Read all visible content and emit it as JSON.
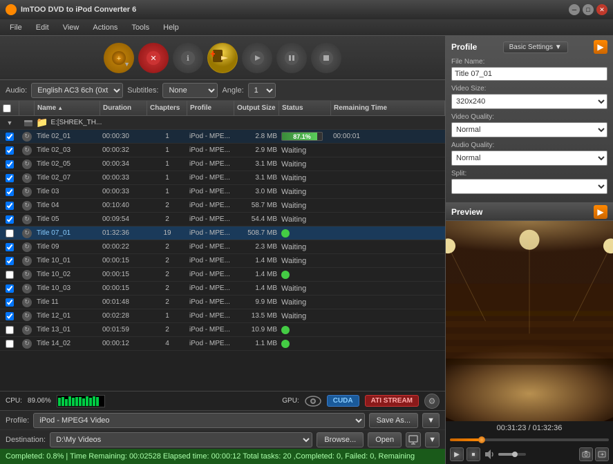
{
  "app": {
    "title": "ImTOO DVD to iPod Converter 6",
    "icon": "dvd-icon"
  },
  "menu": {
    "items": [
      "File",
      "Edit",
      "View",
      "Actions",
      "Tools",
      "Help"
    ]
  },
  "toolbar": {
    "buttons": [
      {
        "id": "add",
        "label": "+",
        "tooltip": "Add"
      },
      {
        "id": "remove",
        "label": "✕",
        "tooltip": "Remove"
      },
      {
        "id": "info",
        "label": "ℹ",
        "tooltip": "Info"
      },
      {
        "id": "convert",
        "label": "▶▶",
        "tooltip": "Convert"
      },
      {
        "id": "play",
        "label": "▶",
        "tooltip": "Play"
      },
      {
        "id": "pause",
        "label": "⏸",
        "tooltip": "Pause"
      },
      {
        "id": "stop",
        "label": "⏹",
        "tooltip": "Stop"
      }
    ]
  },
  "controls": {
    "audio_label": "Audio:",
    "audio_value": "English AC3 6ch (0xt",
    "subtitles_label": "Subtitles:",
    "subtitles_value": "None",
    "angle_label": "Angle:",
    "angle_value": "1"
  },
  "file_list": {
    "columns": [
      "",
      "",
      "Name",
      "Duration",
      "Chapters",
      "Profile",
      "Output Size",
      "Status",
      "Remaining Time"
    ],
    "folder": "E:[SHREK_TH...",
    "files": [
      {
        "name": "Title 02_01",
        "duration": "00:00:30",
        "chapters": "1",
        "profile": "iPod - MPE...",
        "output": "2.8 MB",
        "status": "progress",
        "progress": 87.1,
        "remaining": "00:00:01",
        "checked": true
      },
      {
        "name": "Title 02_03",
        "duration": "00:00:32",
        "chapters": "1",
        "profile": "iPod - MPE...",
        "output": "2.9 MB",
        "status": "Waiting",
        "remaining": "",
        "checked": true
      },
      {
        "name": "Title 02_05",
        "duration": "00:00:34",
        "chapters": "1",
        "profile": "iPod - MPE...",
        "output": "3.1 MB",
        "status": "Waiting",
        "remaining": "",
        "checked": true
      },
      {
        "name": "Title 02_07",
        "duration": "00:00:33",
        "chapters": "1",
        "profile": "iPod - MPE...",
        "output": "3.1 MB",
        "status": "Waiting",
        "remaining": "",
        "checked": true
      },
      {
        "name": "Title 03",
        "duration": "00:00:33",
        "chapters": "1",
        "profile": "iPod - MPE...",
        "output": "3.0 MB",
        "status": "Waiting",
        "remaining": "",
        "checked": true
      },
      {
        "name": "Title 04",
        "duration": "00:10:40",
        "chapters": "2",
        "profile": "iPod - MPE...",
        "output": "58.7 MB",
        "status": "Waiting",
        "remaining": "",
        "checked": true
      },
      {
        "name": "Title 05",
        "duration": "00:09:54",
        "chapters": "2",
        "profile": "iPod - MPE...",
        "output": "54.4 MB",
        "status": "Waiting",
        "remaining": "",
        "checked": true
      },
      {
        "name": "Title 07_01",
        "duration": "01:32:36",
        "chapters": "19",
        "profile": "iPod - MPE...",
        "output": "508.7 MB",
        "status": "green",
        "remaining": "",
        "checked": false,
        "selected": true
      },
      {
        "name": "Title 09",
        "duration": "00:00:22",
        "chapters": "2",
        "profile": "iPod - MPE...",
        "output": "2.3 MB",
        "status": "Waiting",
        "remaining": "",
        "checked": true
      },
      {
        "name": "Title 10_01",
        "duration": "00:00:15",
        "chapters": "2",
        "profile": "iPod - MPE...",
        "output": "1.4 MB",
        "status": "Waiting",
        "remaining": "",
        "checked": true
      },
      {
        "name": "Title 10_02",
        "duration": "00:00:15",
        "chapters": "2",
        "profile": "iPod - MPE...",
        "output": "1.4 MB",
        "status": "green",
        "remaining": "",
        "checked": false
      },
      {
        "name": "Title 10_03",
        "duration": "00:00:15",
        "chapters": "2",
        "profile": "iPod - MPE...",
        "output": "1.4 MB",
        "status": "Waiting",
        "remaining": "",
        "checked": true
      },
      {
        "name": "Title 11",
        "duration": "00:01:48",
        "chapters": "2",
        "profile": "iPod - MPE...",
        "output": "9.9 MB",
        "status": "Waiting",
        "remaining": "",
        "checked": true
      },
      {
        "name": "Title 12_01",
        "duration": "00:02:28",
        "chapters": "1",
        "profile": "iPod - MPE...",
        "output": "13.5 MB",
        "status": "Waiting",
        "remaining": "",
        "checked": true
      },
      {
        "name": "Title 13_01",
        "duration": "00:01:59",
        "chapters": "2",
        "profile": "iPod - MPE...",
        "output": "10.9 MB",
        "status": "green",
        "remaining": "",
        "checked": false
      },
      {
        "name": "Title 14_02",
        "duration": "00:00:12",
        "chapters": "4",
        "profile": "iPod - MPE...",
        "output": "1.1 MB",
        "status": "green",
        "remaining": "",
        "checked": false
      }
    ]
  },
  "cpu_status": {
    "label": "CPU:",
    "value": "89.06%",
    "gpu_label": "GPU:",
    "cuda_label": "CUDA",
    "ati_label": "ATI STREAM"
  },
  "profile_bar": {
    "label": "Profile:",
    "value": "iPod - MPEG4 Video",
    "save_as": "Save As...",
    "dropdown": "▼"
  },
  "dest_bar": {
    "label": "Destination:",
    "value": "D:\\My Videos",
    "browse": "Browse...",
    "open": "Open",
    "dropdown": "▼"
  },
  "bottom_status": {
    "text": "Completed: 0.8%  |  Time Remaining: 00:02528  Elapsed time: 00:00:12  Total tasks: 20 ,Completed: 0, Failed: 0, Remaining"
  },
  "right_panel": {
    "profile_header": "Profile",
    "basic_settings": "Basic Settings ▼",
    "fields": {
      "file_name_label": "File Name:",
      "file_name_value": "Title 07_01",
      "video_size_label": "Video Size:",
      "video_size_value": "320x240",
      "video_quality_label": "Video Quality:",
      "video_quality_value": "Normal",
      "audio_quality_label": "Audio Quality:",
      "audio_quality_value": "Normal",
      "split_label": "Split:"
    },
    "preview_header": "Preview",
    "preview_time": "00:31:23 / 01:32:36",
    "preview_progress": 20
  }
}
